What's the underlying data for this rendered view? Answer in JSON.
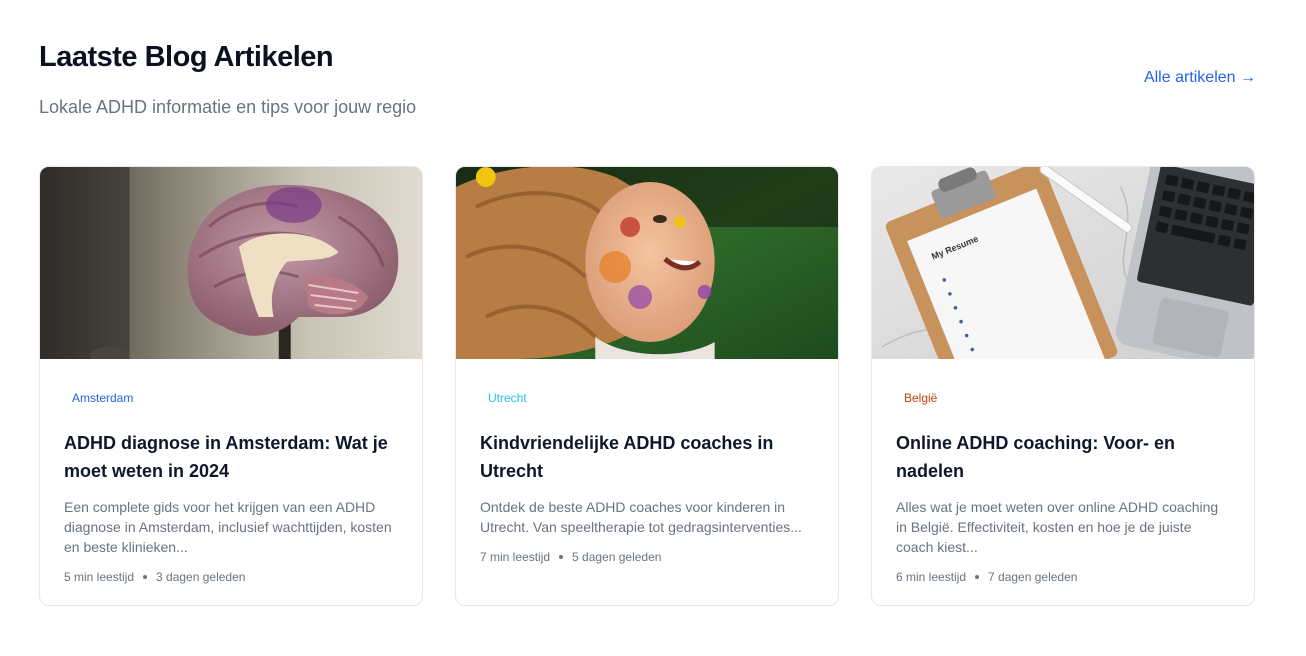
{
  "section": {
    "title": "Laatste Blog Artikelen",
    "subtitle": "Lokale ADHD informatie en tips voor jouw regio",
    "all_link": "Alle artikelen →"
  },
  "colors": {
    "accent": "#2563eb",
    "tag_amsterdam": "#2563eb",
    "tag_utrecht": "#22c4e8",
    "tag_belgie": "#c2410c"
  },
  "articles": [
    {
      "tag": "Amsterdam",
      "image": "brain-model-photo",
      "title": "ADHD diagnose in Amsterdam: Wat je moet weten in 2024",
      "excerpt": "Een complete gids voor het krijgen van een ADHD diagnose in Amsterdam, inclusief wachttijden, kosten en beste klinieken...",
      "read_time": "5 min leestijd",
      "date": "3 dagen geleden"
    },
    {
      "tag": "Utrecht",
      "image": "painted-child-photo",
      "title": "Kindvriendelijke ADHD coaches in Utrecht",
      "excerpt": "Ontdek de beste ADHD coaches voor kinderen in Utrecht. Van speeltherapie tot gedragsinterventies...",
      "read_time": "7 min leestijd",
      "date": "5 dagen geleden"
    },
    {
      "tag": "België",
      "image": "clipboard-laptop-photo",
      "title": "Online ADHD coaching: Voor- en nadelen",
      "excerpt": "Alles wat je moet weten over online ADHD coaching in België. Effectiviteit, kosten en hoe je de juiste coach kiest...",
      "read_time": "6 min leestijd",
      "date": "7 dagen geleden",
      "image_text": "My Resume"
    }
  ]
}
